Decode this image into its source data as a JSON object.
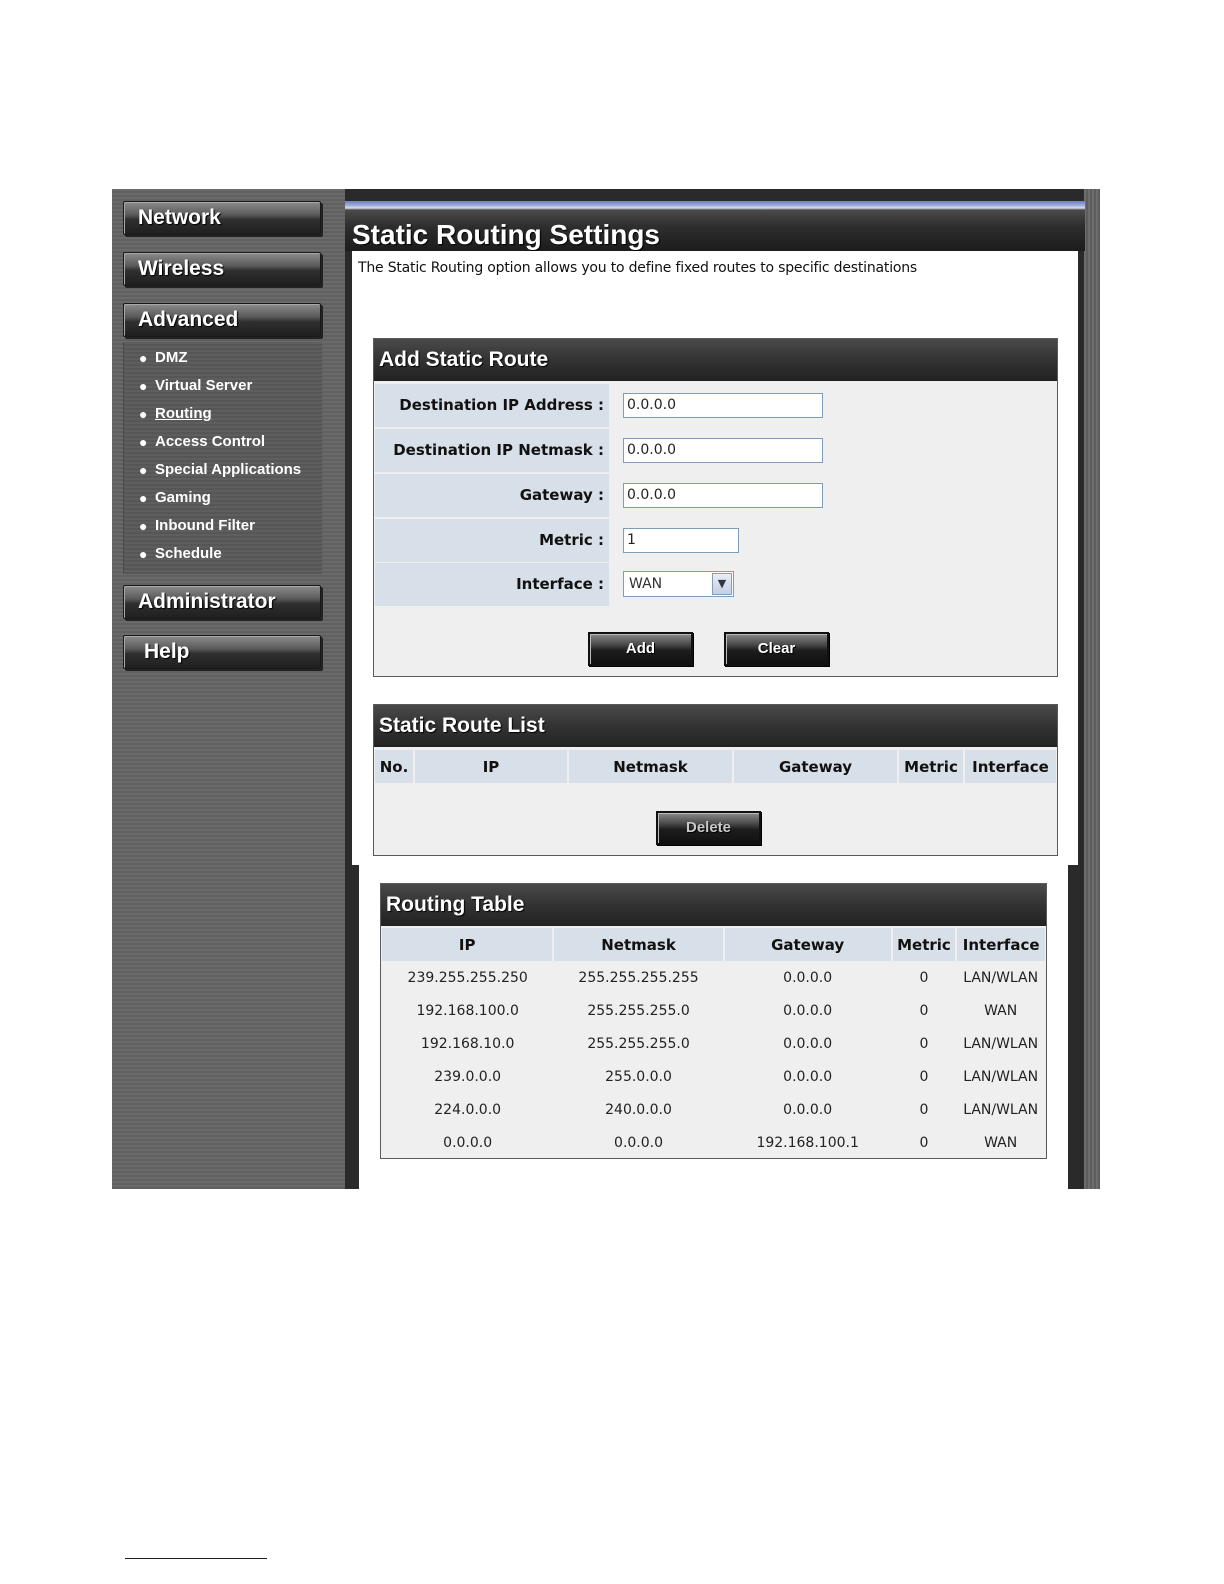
{
  "sidebar": {
    "network": "Network",
    "wireless": "Wireless",
    "advanced": "Advanced",
    "submenu": [
      "DMZ",
      "Virtual Server",
      "Routing",
      "Access Control",
      "Special Applications",
      "Gaming",
      "Inbound Filter",
      "Schedule"
    ],
    "bullet": "●",
    "administrator": "Administrator",
    "help": "Help"
  },
  "page": {
    "title": "Static Routing Settings",
    "description": "The Static Routing option allows you to define fixed routes to specific destinations"
  },
  "add_route": {
    "title": "Add Static Route",
    "dest_ip_label": "Destination IP Address :",
    "dest_ip_value": "0.0.0.0",
    "netmask_label": "Destination IP Netmask :",
    "netmask_value": "0.0.0.0",
    "gateway_label": "Gateway :",
    "gateway_value": "0.0.0.0",
    "metric_label": "Metric :",
    "metric_value": "1",
    "interface_label": "Interface :",
    "interface_value": "WAN",
    "dropdown_arrow": "▼",
    "add_button": "Add",
    "clear_button": "Clear"
  },
  "route_list": {
    "title": "Static Route List",
    "headers": [
      "No.",
      "IP",
      "Netmask",
      "Gateway",
      "Metric",
      "Interface"
    ],
    "delete_button": "Delete"
  },
  "routing_table": {
    "title": "Routing Table",
    "headers": [
      "IP",
      "Netmask",
      "Gateway",
      "Metric",
      "Interface"
    ],
    "rows": [
      [
        "239.255.255.250",
        "255.255.255.255",
        "0.0.0.0",
        "0",
        "LAN/WLAN"
      ],
      [
        "192.168.100.0",
        "255.255.255.0",
        "0.0.0.0",
        "0",
        "WAN"
      ],
      [
        "192.168.10.0",
        "255.255.255.0",
        "0.0.0.0",
        "0",
        "LAN/WLAN"
      ],
      [
        "239.0.0.0",
        "255.0.0.0",
        "0.0.0.0",
        "0",
        "LAN/WLAN"
      ],
      [
        "224.0.0.0",
        "240.0.0.0",
        "0.0.0.0",
        "0",
        "LAN/WLAN"
      ],
      [
        "0.0.0.0",
        "0.0.0.0",
        "192.168.100.1",
        "0",
        "WAN"
      ]
    ]
  }
}
